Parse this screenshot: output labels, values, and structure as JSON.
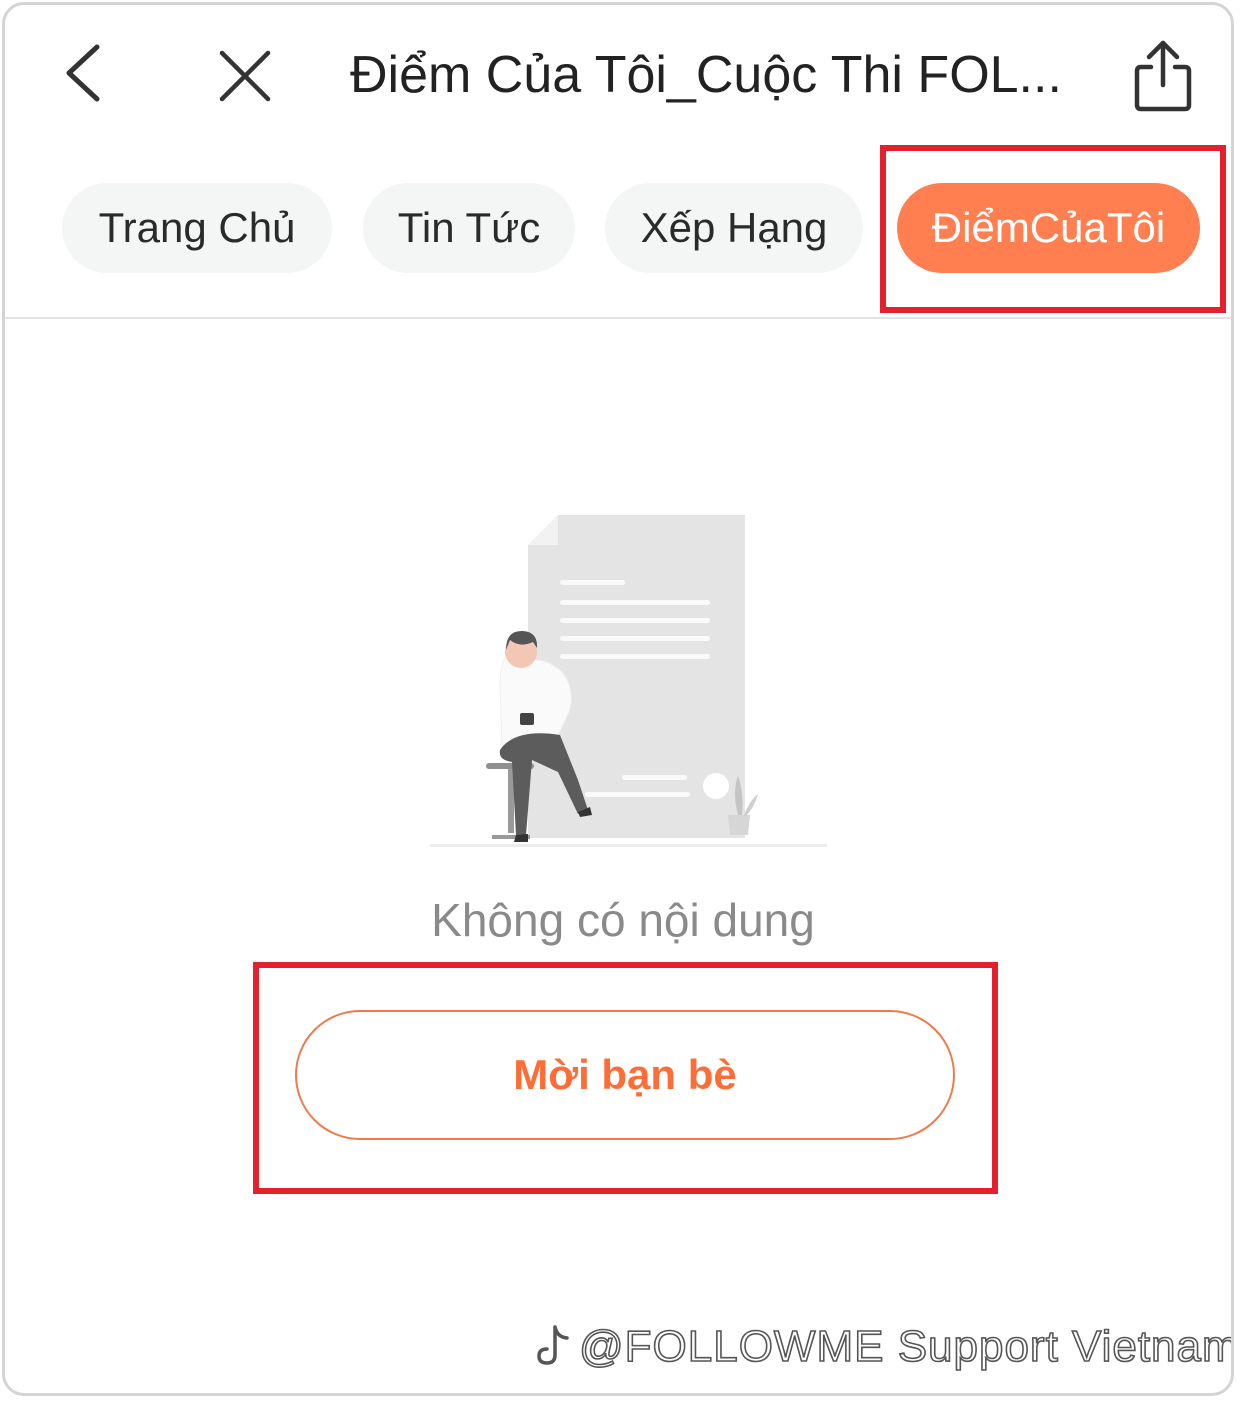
{
  "header": {
    "title": "Điểm Của Tôi_Cuộc Thi FOL...",
    "back_icon": "chevron-left-icon",
    "close_icon": "close-icon",
    "share_icon": "share-icon"
  },
  "tabs": [
    {
      "label": "Trang Chủ",
      "active": false
    },
    {
      "label": "Tin Tức",
      "active": false
    },
    {
      "label": "Xếp Hạng",
      "active": false
    },
    {
      "label": "ĐiểmCủaTôi",
      "active": true
    }
  ],
  "empty_state": {
    "illustration": "empty-document-illustration",
    "message": "Không có nội dung",
    "button_label": "Mời bạn bè"
  },
  "watermark": {
    "text": "@FOLLOWME Support Vietnam",
    "logo": "tiktok-logo-icon"
  },
  "colors": {
    "accent": "#ff7f50",
    "button_text": "#ff6d36",
    "highlight": "#e3202b",
    "tab_bg": "#f4f6f6"
  }
}
